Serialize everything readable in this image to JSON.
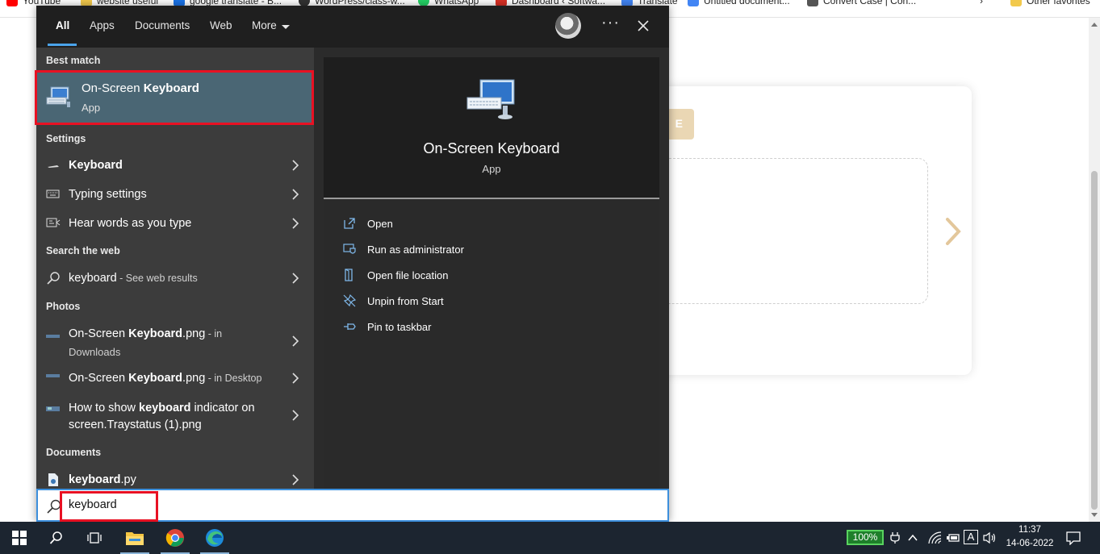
{
  "bookmarks": [
    {
      "label": "YouTube",
      "color": "#ff0000"
    },
    {
      "label": "website useful",
      "color": "#f2c94c"
    },
    {
      "label": "google translate - B...",
      "color": "#1a73e8"
    },
    {
      "label": "WordPress/class-w...",
      "color": "#333333"
    },
    {
      "label": "WhatsApp",
      "color": "#25d366"
    },
    {
      "label": "Dashboard ‹ Softwa...",
      "color": "#d93025"
    },
    {
      "label": "Translate",
      "color": "#4285f4"
    },
    {
      "label": "Untitled document...",
      "color": "#4285f4"
    },
    {
      "label": "Convert Case | Con...",
      "color": "#555555"
    },
    {
      "label": "Other favorites",
      "color": "#f2c94c"
    }
  ],
  "background_page": {
    "tag_text": "E"
  },
  "start_menu": {
    "tabs": [
      "All",
      "Apps",
      "Documents",
      "Web",
      "More"
    ],
    "active_tab": "All",
    "sections": {
      "best_match": "Best match",
      "settings": "Settings",
      "search_web": "Search the web",
      "photos": "Photos",
      "documents": "Documents"
    },
    "best_match": {
      "title_prefix": "On-Screen ",
      "title_bold": "Keyboard",
      "subtitle": "App"
    },
    "settings_items": [
      {
        "label": "Keyboard",
        "icon": "keyboard-mini-icon"
      },
      {
        "label": "Typing settings",
        "icon": "keyboard-icon"
      },
      {
        "label": "Hear words as you type",
        "icon": "narrator-icon"
      }
    ],
    "web_item": {
      "bold": "keyboard",
      "suffix": " - See web results"
    },
    "photo_items": [
      {
        "pre": "On-Screen ",
        "bold": "Keyboard",
        "post": ".png",
        "loc": " - in",
        "line2": "Downloads"
      },
      {
        "pre": "On-Screen ",
        "bold": "Keyboard",
        "post": ".png",
        "loc": " - in Desktop",
        "line2": ""
      },
      {
        "pre": "How to show ",
        "bold": "keyboard",
        "post": " indicator on",
        "loc": "",
        "line2": "screen.Traystatus (1).png"
      }
    ],
    "document_item": {
      "bold": "keyboard",
      "post": ".py"
    },
    "preview": {
      "title": "On-Screen Keyboard",
      "type": "App",
      "actions": [
        "Open",
        "Run as administrator",
        "Open file location",
        "Unpin from Start",
        "Pin to taskbar"
      ]
    },
    "search": {
      "value": "keyboard"
    }
  },
  "taskbar": {
    "battery": "100%",
    "time": "11:37",
    "date": "14-06-2022",
    "ime": "A"
  },
  "colors": {
    "accent": "#4aa3ea",
    "highlight": "#e81123",
    "selected": "#4a6674"
  }
}
